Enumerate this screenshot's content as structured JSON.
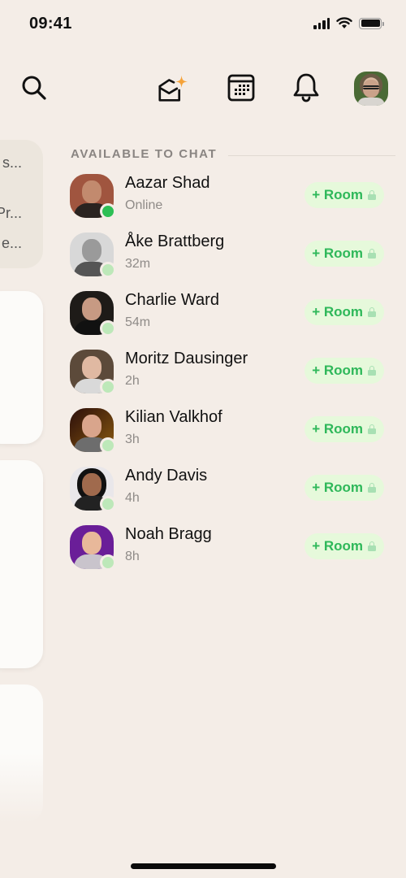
{
  "status_bar": {
    "time": "09:41",
    "icons": [
      "cellular-signal-icon",
      "wifi-icon",
      "battery-icon"
    ]
  },
  "toolbar": {
    "buttons": [
      {
        "name": "search",
        "icon": "search-icon"
      },
      {
        "name": "inbox",
        "icon": "envelope-sparkle-icon",
        "accent": "#f5a33a"
      },
      {
        "name": "calendar",
        "icon": "calendar-icon"
      },
      {
        "name": "notifications",
        "icon": "bell-icon"
      },
      {
        "name": "profile",
        "icon": "user-avatar"
      }
    ]
  },
  "left_panel": {
    "card_1_lines": [
      "s...",
      "Pr...",
      "e..."
    ]
  },
  "available": {
    "title": "AVAILABLE TO CHAT",
    "room_button_label": "+ Room",
    "colors": {
      "online": "#2dbf55",
      "away": "#bde8b9",
      "room_bg": "#e6f9db",
      "room_text": "#2fb85a"
    },
    "contacts": [
      {
        "name": "Aazar Shad",
        "status": "Online",
        "presence": "online"
      },
      {
        "name": "Åke Brattberg",
        "status": "32m",
        "presence": "away"
      },
      {
        "name": "Charlie Ward",
        "status": "54m",
        "presence": "away"
      },
      {
        "name": "Moritz Dausinger",
        "status": "2h",
        "presence": "away"
      },
      {
        "name": "Kilian Valkhof",
        "status": "3h",
        "presence": "away"
      },
      {
        "name": "Andy Davis",
        "status": "4h",
        "presence": "away"
      },
      {
        "name": "Noah Bragg",
        "status": "8h",
        "presence": "away"
      }
    ]
  }
}
